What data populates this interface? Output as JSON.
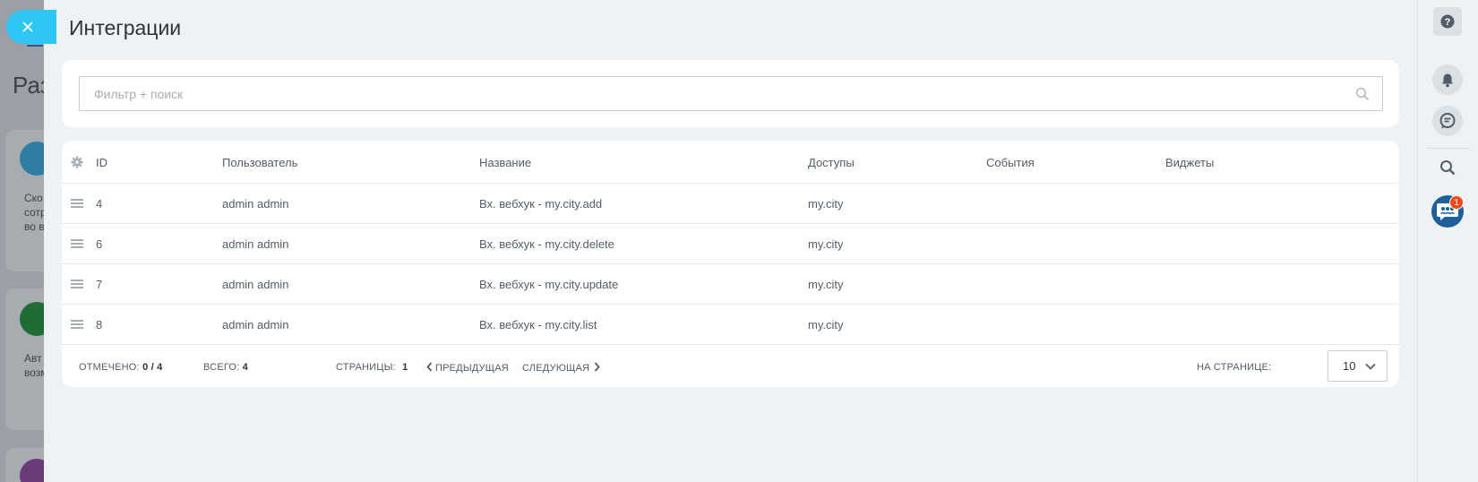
{
  "background": {
    "title_fragment": "Раз",
    "card1_text": [
      "Ско",
      "сотр",
      "во в"
    ],
    "card2_text": [
      "Авт",
      "возм"
    ]
  },
  "close_button": {
    "icon": "close-icon"
  },
  "panel": {
    "title": "Интеграции",
    "search": {
      "placeholder": "Фильтр + поиск",
      "value": ""
    }
  },
  "grid": {
    "columns": [
      "ID",
      "Пользователь",
      "Название",
      "Доступы",
      "События",
      "Виджеты"
    ],
    "rows": [
      {
        "id": "4",
        "user": "admin admin",
        "name": "Вх. вебхук - my.city.add",
        "access": "my.city",
        "events": "",
        "widgets": ""
      },
      {
        "id": "6",
        "user": "admin admin",
        "name": "Вх. вебхук - my.city.delete",
        "access": "my.city",
        "events": "",
        "widgets": ""
      },
      {
        "id": "7",
        "user": "admin admin",
        "name": "Вх. вебхук - my.city.update",
        "access": "my.city",
        "events": "",
        "widgets": ""
      },
      {
        "id": "8",
        "user": "admin admin",
        "name": "Вх. вебхук - my.city.list",
        "access": "my.city",
        "events": "",
        "widgets": ""
      }
    ],
    "footer": {
      "selected_label": "ОТМЕЧЕНО:",
      "selected_value": "0 / 4",
      "total_label": "ВСЕГО:",
      "total_value": "4",
      "pages_label": "СТРАНИЦЫ:",
      "pages_value": "1",
      "prev_label": "ПРЕДЫДУЩАЯ",
      "next_label": "СЛЕДУЮЩАЯ",
      "per_page_label": "НА СТРАНИЦЕ:",
      "per_page_value": "10"
    }
  },
  "rail": {
    "notification_count": "1",
    "colors": {
      "accent": "#2fc6f6",
      "openlines": "#1f5f99",
      "badge": "#f54819"
    }
  }
}
